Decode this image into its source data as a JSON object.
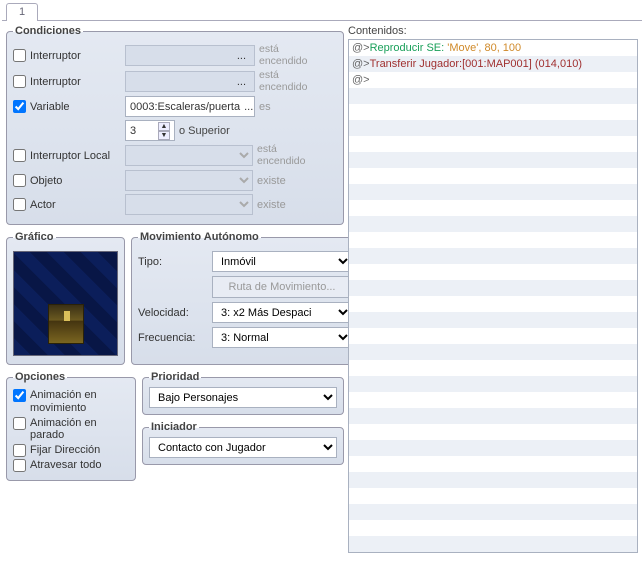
{
  "tab": {
    "label": "1"
  },
  "conditions": {
    "legend": "Condiciones",
    "switch1": {
      "label": "Interruptor",
      "checked": false,
      "value": "",
      "hint": "está encendido"
    },
    "switch2": {
      "label": "Interruptor",
      "checked": false,
      "value": "",
      "hint": "está encendido"
    },
    "variable": {
      "label": "Variable",
      "checked": true,
      "value": "0003:Escaleras/puerta",
      "hint": "es",
      "number": "3",
      "numHint": "o Superior"
    },
    "localSwitch": {
      "label": "Interruptor Local",
      "checked": false,
      "value": "",
      "hint": "está encendido"
    },
    "item": {
      "label": "Objeto",
      "checked": false,
      "value": "",
      "hint": "existe"
    },
    "actor": {
      "label": "Actor",
      "checked": false,
      "value": "",
      "hint": "existe"
    }
  },
  "graphic": {
    "legend": "Gráfico"
  },
  "movement": {
    "legend": "Movimiento Autónomo",
    "typeLabel": "Tipo:",
    "type": "Inmóvil",
    "routeBtn": "Ruta de Movimiento...",
    "speedLabel": "Velocidad:",
    "speed": "3: x2 Más Despaci",
    "freqLabel": "Frecuencia:",
    "freq": "3: Normal"
  },
  "options": {
    "legend": "Opciones",
    "walkAnim": {
      "label": "Animación en movimiento",
      "checked": true
    },
    "stepAnim": {
      "label": "Animación en parado",
      "checked": false
    },
    "fixDir": {
      "label": "Fijar Dirección",
      "checked": false
    },
    "through": {
      "label": "Atravesar todo",
      "checked": false
    }
  },
  "priority": {
    "legend": "Prioridad",
    "value": "Bajo Personajes"
  },
  "trigger": {
    "legend": "Iniciador",
    "value": "Contacto con Jugador"
  },
  "contents": {
    "label": "Contenidos:",
    "cmds": [
      {
        "at": "@>",
        "cmd": "Reproducir SE:",
        "args": " 'Move', 80, 100",
        "cmdClass": "se-cmd",
        "argClass": "se-args"
      },
      {
        "at": "@>",
        "cmd": "Transferir Jugador:",
        "args": "[001:MAP001] (014,010)",
        "cmdClass": "tr-cmd",
        "argClass": "tr-args"
      },
      {
        "at": "@>",
        "cmd": "",
        "args": "",
        "cmdClass": "",
        "argClass": ""
      }
    ]
  }
}
